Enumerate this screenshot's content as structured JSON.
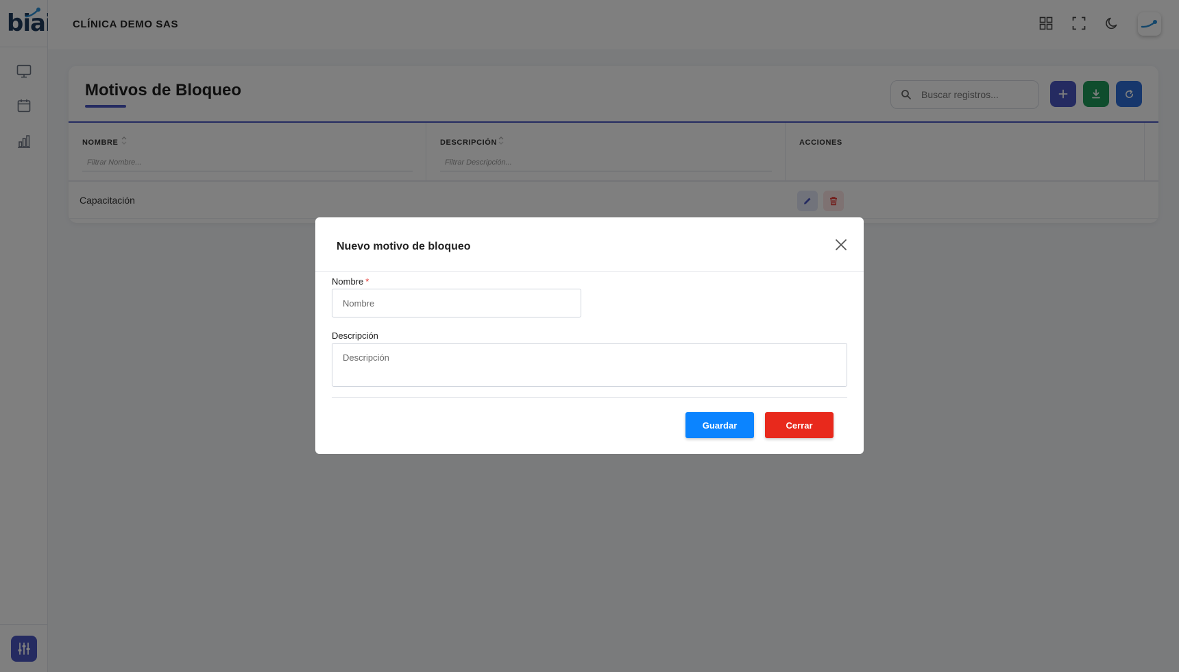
{
  "app": {
    "logo_text": "biai",
    "company": "CLÍNICA DEMO SAS"
  },
  "sidebar": {
    "items": [
      {
        "icon": "monitor-icon"
      },
      {
        "icon": "calendar-icon"
      },
      {
        "icon": "bar-chart-icon"
      }
    ],
    "settings_icon": "sliders-icon"
  },
  "header": {
    "icons": [
      "grid-icon",
      "fullscreen-icon",
      "moon-icon"
    ]
  },
  "page": {
    "title": "Motivos de Bloqueo",
    "search_placeholder": "Buscar registros...",
    "buttons": {
      "add_color": "#4b57c2",
      "export_color": "#1e9a5a",
      "refresh_color": "#2f6fd8"
    }
  },
  "table": {
    "columns": [
      {
        "label": "NOMBRE",
        "filter_placeholder": "Filtrar Nombre..."
      },
      {
        "label": "DESCRIPCIÓN",
        "filter_placeholder": "Filtrar Descripción..."
      },
      {
        "label": "ACCIONES"
      }
    ],
    "rows": [
      {
        "nombre": "Capacitación",
        "descripcion": ""
      }
    ]
  },
  "modal": {
    "title": "Nuevo motivo de bloqueo",
    "nombre_label": "Nombre",
    "required_mark": "*",
    "nombre_placeholder": "Nombre",
    "descripcion_label": "Descripción",
    "descripcion_placeholder": "Descripción",
    "save_label": "Guardar",
    "close_label": "Cerrar",
    "save_color": "#0b84ff",
    "close_color": "#e8291c"
  }
}
